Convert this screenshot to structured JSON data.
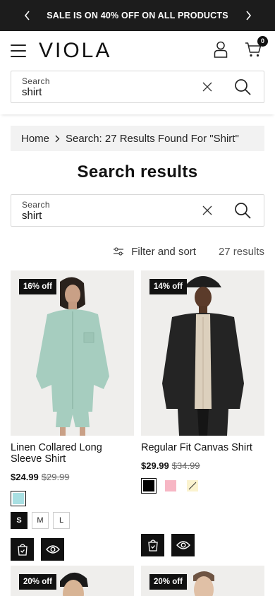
{
  "announcement": {
    "text": "SALE IS ON 40% OFF ON ALL PRODUCTS"
  },
  "header": {
    "logo": "VIOLA",
    "cart_count": "0"
  },
  "search_top": {
    "label": "Search",
    "value": "shirt"
  },
  "breadcrumb": {
    "home": "Home",
    "current": "Search: 27 Results Found For \"Shirt\""
  },
  "page_title": "Search results",
  "search_main": {
    "label": "Search",
    "value": "shirt"
  },
  "filter": {
    "label": "Filter and sort",
    "count": "27 results"
  },
  "products": [
    {
      "badge": "16% off",
      "title": "Linen Collared Long Sleeve Shirt",
      "price": "$24.99",
      "compare_price": "$29.99",
      "swatch_colors": [
        "#a8dfe2"
      ],
      "sizes": [
        "S",
        "M",
        "L"
      ],
      "selected_size": "S"
    },
    {
      "badge": "14% off",
      "title": "Regular Fit Canvas Shirt",
      "price": "$29.99",
      "compare_price": "$34.99",
      "swatch_colors": [
        "#000000",
        "#f7b6c4",
        "#fbf3cf"
      ]
    },
    {
      "badge": "20% off"
    },
    {
      "badge": "20% off"
    }
  ]
}
